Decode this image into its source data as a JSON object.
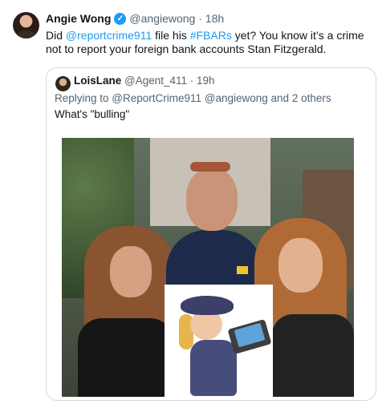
{
  "tweet": {
    "author_name": "Angie Wong",
    "verified_glyph": "✓",
    "handle_time": "@angiewong · 18h",
    "text_parts": [
      {
        "kind": "plain",
        "text": "Did "
      },
      {
        "kind": "link",
        "text": "@reportcrime911"
      },
      {
        "kind": "plain",
        "text": " file his "
      },
      {
        "kind": "link",
        "text": "#FBARs"
      },
      {
        "kind": "plain",
        "text": " yet? You know it’s a crime not to report your foreign bank accounts Stan Fitzgerald."
      }
    ]
  },
  "quoted": {
    "author_name": "LoisLane",
    "handle_time": "@Agent_411 · 19h",
    "reply_line": "Replying to @ReportCrime911 @angiewong and 2 others",
    "text": "What's \"bulling\""
  },
  "icons": {
    "verified": "verified-badge-icon",
    "avatar_main": "angie-wong-avatar",
    "avatar_quote": "loislane-avatar"
  },
  "colors": {
    "link": "#1d9bf0",
    "muted": "#536471",
    "border": "#cfd9de"
  }
}
